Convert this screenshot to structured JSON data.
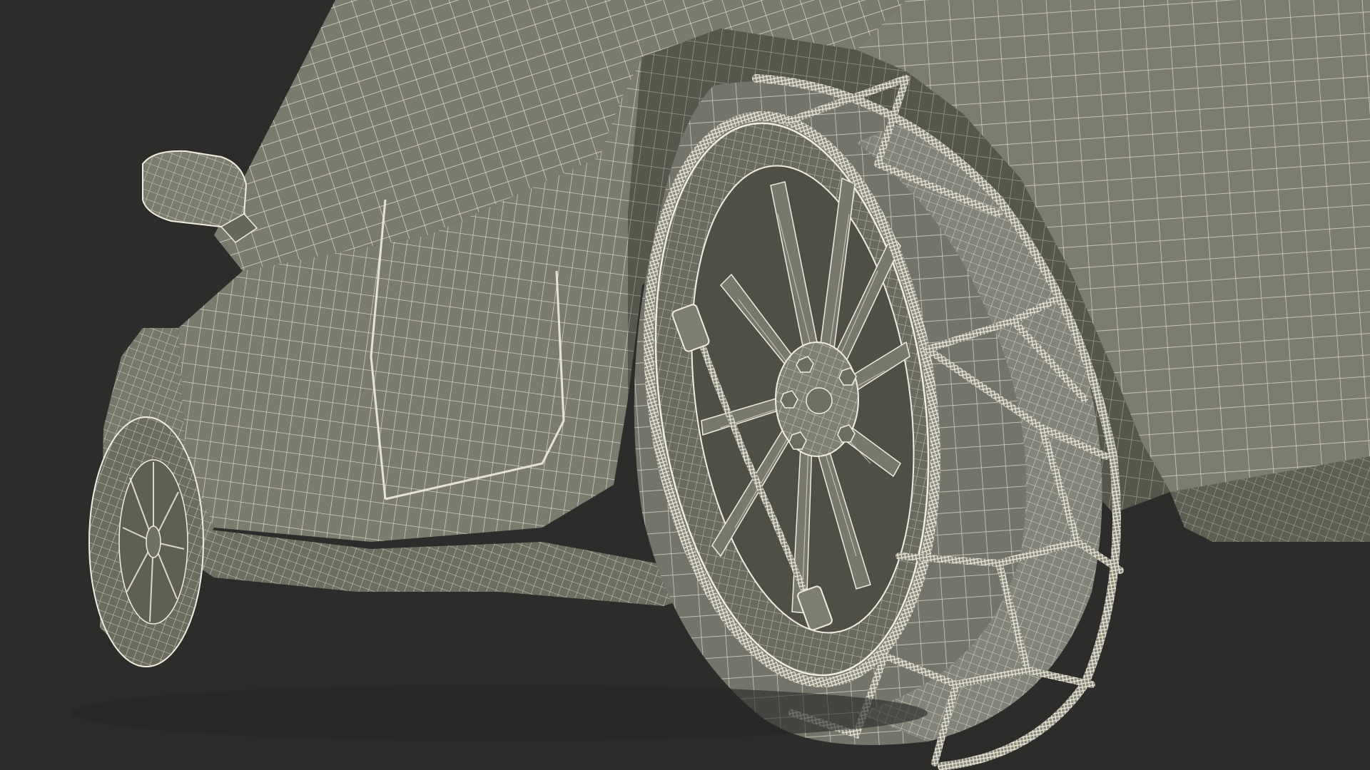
{
  "scene": {
    "description_visible_text": "",
    "colors": {
      "background": "#2d2c2b",
      "body_fill": "#7b7b6d",
      "body_fill_dark": "#5f5f53",
      "body_fill_shadow": "#4a4a41",
      "wire": "#efeedd",
      "wire_dim": "#cfcebd"
    },
    "objects": [
      {
        "name": "car-body",
        "kind": "wireframe-mesh"
      },
      {
        "name": "side-mirror",
        "kind": "wireframe-mesh"
      },
      {
        "name": "front-wheel",
        "kind": "wireframe-mesh"
      },
      {
        "name": "rear-wheel",
        "kind": "wireframe-mesh"
      },
      {
        "name": "snow-chain",
        "kind": "wireframe-mesh"
      }
    ]
  }
}
